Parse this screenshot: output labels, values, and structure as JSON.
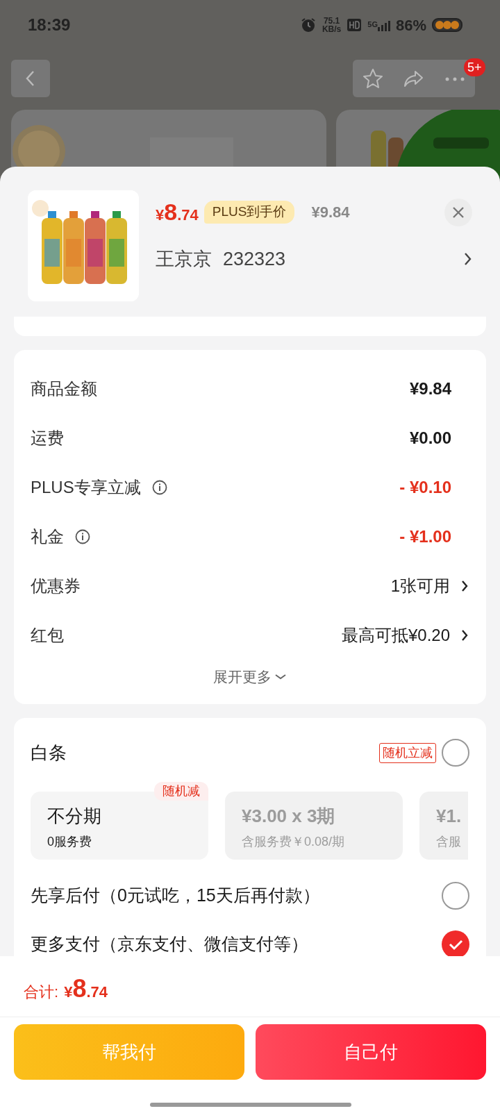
{
  "status_bar": {
    "time": "18:39",
    "speed_value": "75.1",
    "speed_unit": "KB/s",
    "network": "5G",
    "battery": "86%"
  },
  "top_bar": {
    "badge": "5+"
  },
  "product": {
    "price_symbol": "¥",
    "price_int": "8",
    "price_dec": ".74",
    "plus_tag": "PLUS到手价",
    "original_price": "¥9.84",
    "name": "王京京",
    "number": "232323"
  },
  "costs": [
    {
      "label": "商品金额",
      "value": "¥9.84",
      "kind": "plain",
      "info": false
    },
    {
      "label": "运费",
      "value": "¥0.00",
      "kind": "plain",
      "info": false
    },
    {
      "label": "PLUS专享立减",
      "value": "- ¥0.10",
      "kind": "discount",
      "info": true
    },
    {
      "label": "礼金",
      "value": "- ¥1.00",
      "kind": "discount",
      "info": true
    },
    {
      "label": "优惠券",
      "value": "1张可用",
      "kind": "link",
      "info": false
    },
    {
      "label": "红包",
      "value": "最高可抵¥0.20",
      "kind": "link",
      "info": false
    }
  ],
  "expand": "展开更多",
  "baitiao": {
    "title": "白条",
    "tag": "随机立减",
    "selected": false,
    "plans": [
      {
        "title": "不分期",
        "subtitle": "0服务费",
        "badge": "随机减",
        "disabled": false
      },
      {
        "title": "¥3.00 x 3期",
        "subtitle": "含服务费￥0.08/期",
        "disabled": true
      },
      {
        "title": "¥1.",
        "subtitle": "含服",
        "disabled": true
      }
    ]
  },
  "pay_options": [
    {
      "label": "先享后付（0元试吃，15天后再付款）",
      "selected": false
    },
    {
      "label": "更多支付（京东支付、微信支付等）",
      "selected": true
    }
  ],
  "footer": {
    "total_label": "合计:",
    "symbol": "¥",
    "int": "8",
    "dec": ".74"
  },
  "buttons": [
    {
      "label": "帮我付",
      "kind": "secondary"
    },
    {
      "label": "自己付",
      "kind": "primary"
    }
  ]
}
